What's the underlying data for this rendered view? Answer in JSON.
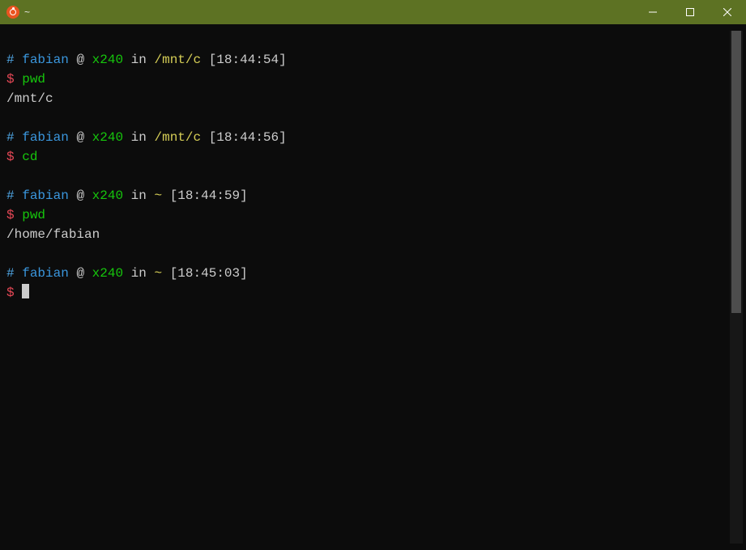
{
  "window": {
    "title": "~"
  },
  "prompt": {
    "hash": "#",
    "user": "fabian",
    "at": "@",
    "host": "x240",
    "in": "in",
    "dollar": "$"
  },
  "blocks": [
    {
      "cwd": "/mnt/c",
      "time": "[18:44:54]",
      "cmd": "pwd",
      "output": "/mnt/c"
    },
    {
      "cwd": "/mnt/c",
      "time": "[18:44:56]",
      "cmd": "cd",
      "output": ""
    },
    {
      "cwd": "~",
      "time": "[18:44:59]",
      "cmd": "pwd",
      "output": "/home/fabian"
    },
    {
      "cwd": "~",
      "time": "[18:45:03]",
      "cmd": "",
      "output": null
    }
  ]
}
